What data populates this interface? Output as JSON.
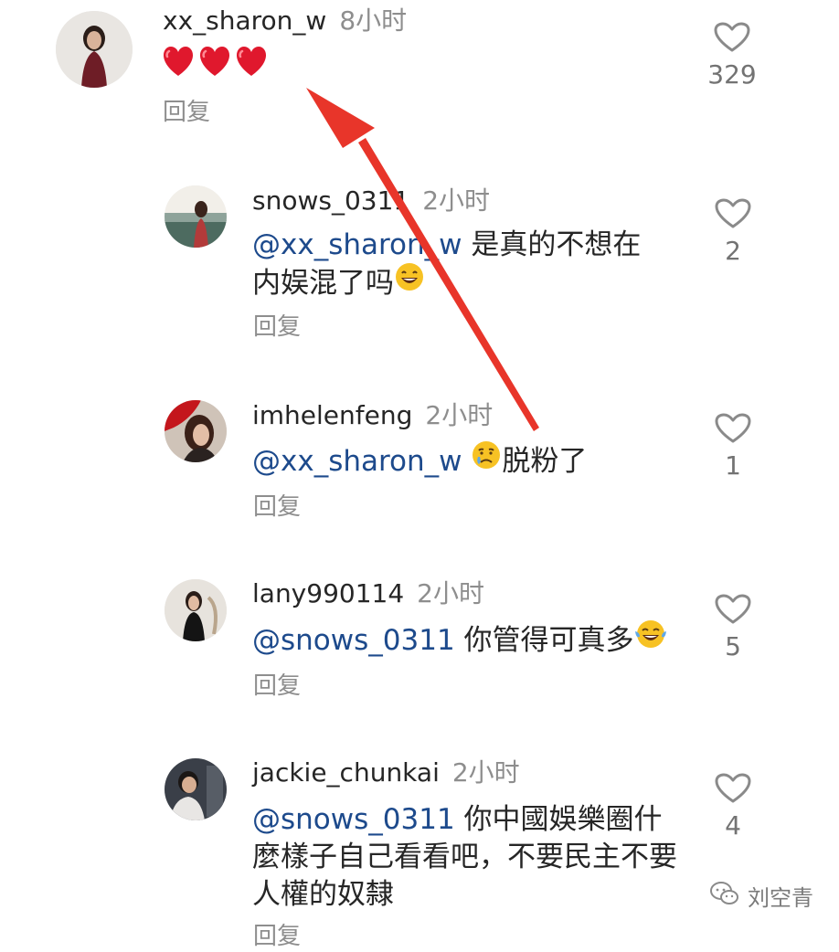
{
  "comments": [
    {
      "username": "xx_sharon_w",
      "time": "8小时",
      "text": "",
      "emoji": [
        "red-heart",
        "red-heart",
        "red-heart"
      ],
      "reply_label": "回复",
      "likes": "329"
    },
    {
      "username": "snows_0311",
      "time": "2小时",
      "mention": "@xx_sharon_w",
      "text": " 是真的不想在内娱混了吗",
      "emoji": [
        "grinning-face"
      ],
      "reply_label": "回复",
      "likes": "2"
    },
    {
      "username": "imhelenfeng",
      "time": "2小时",
      "mention": "@xx_sharon_w",
      "text_after_emoji": "脱粉了",
      "emoji": [
        "crying-face"
      ],
      "reply_label": "回复",
      "likes": "1"
    },
    {
      "username": "lany990114",
      "time": "2小时",
      "mention": "@snows_0311",
      "text": " 你管得可真多",
      "emoji": [
        "tears-of-joy-face"
      ],
      "reply_label": "回复",
      "likes": "5"
    },
    {
      "username": "jackie_chunkai",
      "time": "2小时",
      "mention": "@snows_0311",
      "text": " 你中國娛樂圈什麼樣子自己看看吧，不要民主不要人權的奴隸",
      "reply_label": "回复",
      "likes": "4"
    }
  ],
  "watermark": {
    "icon": "wechat-icon",
    "text": "刘空青"
  },
  "colors": {
    "mention": "#1d4a8c",
    "arrow": "#e8352a",
    "muted": "#8e8e8e"
  }
}
